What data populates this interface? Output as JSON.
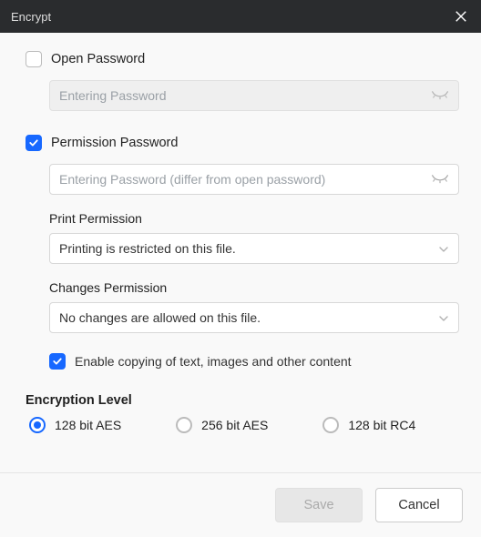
{
  "title": "Encrypt",
  "open_password": {
    "label": "Open Password",
    "checked": false,
    "placeholder": "Entering Password",
    "value": ""
  },
  "permission_password": {
    "label": "Permission Password",
    "checked": true,
    "placeholder": "Entering Password (differ from open password)",
    "value": ""
  },
  "print_permission": {
    "label": "Print Permission",
    "selected": "Printing is restricted on this file."
  },
  "changes_permission": {
    "label": "Changes Permission",
    "selected": "No changes are allowed on this file."
  },
  "enable_copy": {
    "label": "Enable copying of text, images and other content",
    "checked": true
  },
  "encryption_level": {
    "label": "Encryption Level",
    "options": [
      "128 bit AES",
      "256 bit AES",
      "128 bit RC4"
    ],
    "selected": "128 bit AES"
  },
  "footer": {
    "save": "Save",
    "cancel": "Cancel"
  }
}
